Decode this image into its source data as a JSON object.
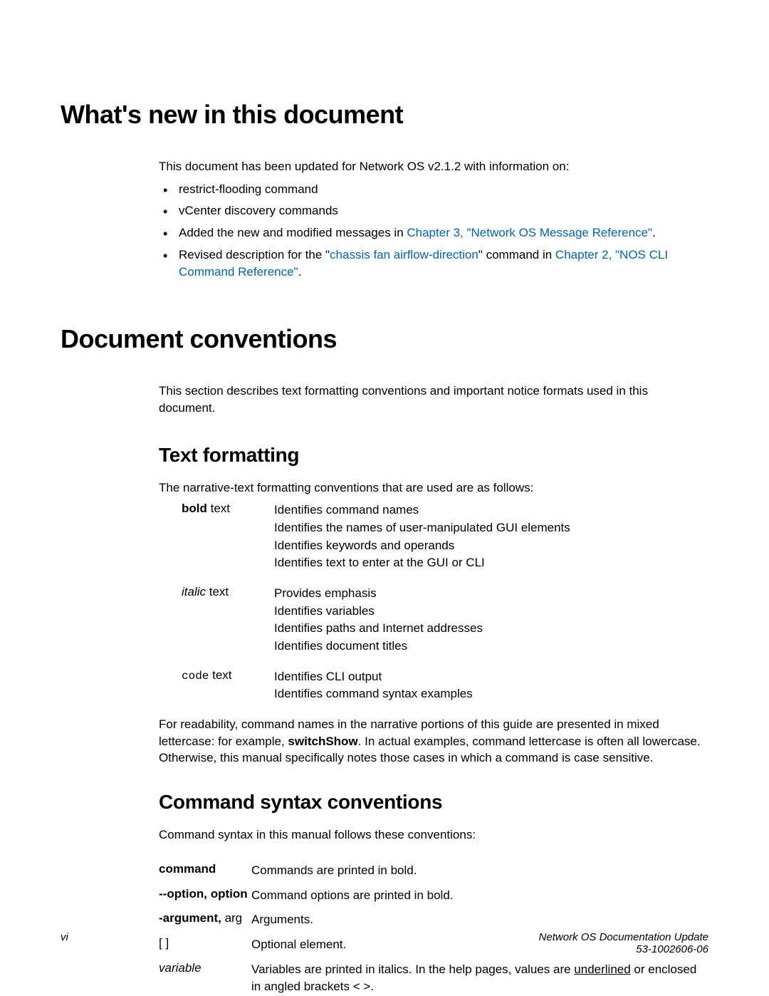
{
  "heading1": "What's new in this document",
  "intro1": "This document has been updated for Network OS v2.1.2 with information on:",
  "bullets": {
    "b1": "restrict-flooding command",
    "b2": "vCenter discovery commands",
    "b3_pre": "Added the new and modified messages in ",
    "b3_link": "Chapter 3, \"Network OS Message Reference\"",
    "b3_post": ".",
    "b4_pre": "Revised description for the \"",
    "b4_link1": "chassis fan airflow-direction",
    "b4_mid": "\" command in ",
    "b4_link2": "Chapter 2, \"NOS CLI Command Reference\"",
    "b4_post": "."
  },
  "heading2": "Document conventions",
  "intro2": "This section describes text formatting conventions and important notice formats used in this document.",
  "sub1": "Text formatting",
  "sub1_intro": "The narrative-text formatting conventions that are used are as follows:",
  "fmt": {
    "bold_label_b": "bold",
    "bold_label_t": " text",
    "bold_l1": "Identifies command names",
    "bold_l2": "Identifies the names of user-manipulated GUI elements",
    "bold_l3": "Identifies keywords and operands",
    "bold_l4": "Identifies text to enter at the GUI or CLI",
    "italic_label_i": "italic",
    "italic_label_t": " text",
    "italic_l1": "Provides emphasis",
    "italic_l2": "Identifies variables",
    "italic_l3": "Identifies paths and Internet addresses",
    "italic_l4": "Identifies document titles",
    "code_label_c": "code",
    "code_label_t": " text",
    "code_l1": "Identifies CLI output",
    "code_l2": "Identifies command syntax examples"
  },
  "readability_p1": "For readability, command names in the narrative portions of this guide are presented in mixed lettercase: for example, ",
  "readability_bold": "switchShow",
  "readability_p2": ". In actual examples, command lettercase is often all lowercase. Otherwise, this manual specifically notes those cases in which a command is case sensitive.",
  "sub2": "Command syntax conventions",
  "sub2_intro": "Command syntax in this manual follows these conventions:",
  "syntax": {
    "r1_label": "command",
    "r1_desc": "Commands are printed in bold.",
    "r2_label": "--option, option",
    "r2_desc": "Command options are printed in bold.",
    "r3_label_b": "-argument,",
    "r3_label_t": " arg",
    "r3_desc": "Arguments.",
    "r4_label": "[ ]",
    "r4_desc": "Optional element.",
    "r5_label": "variable",
    "r5_desc_pre": "Variables are printed in italics. In the help pages, values are ",
    "r5_desc_u": "underlined",
    "r5_desc_post": " or enclosed in angled brackets < >."
  },
  "footer": {
    "left": "vi",
    "right1": "Network OS Documentation Update",
    "right2": "53-1002606-06"
  }
}
